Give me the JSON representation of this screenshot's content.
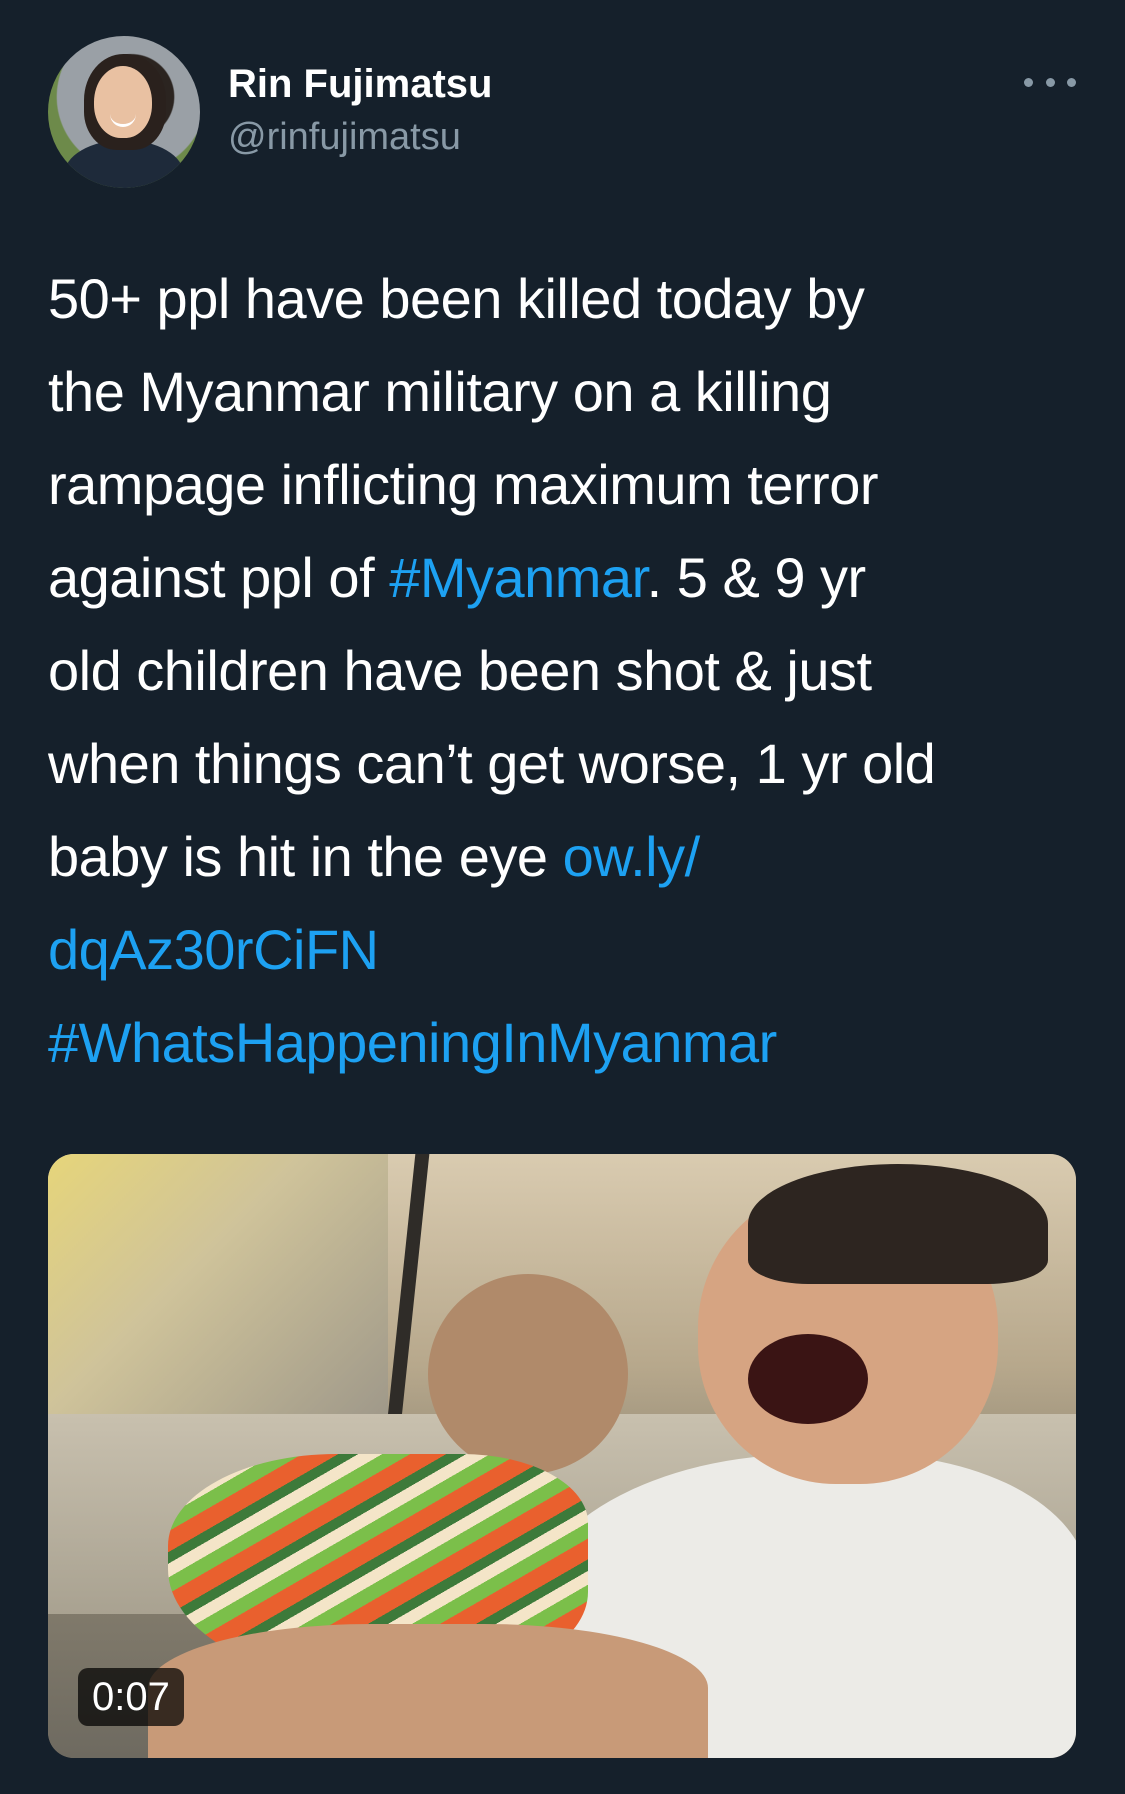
{
  "tweet": {
    "author": {
      "display_name": "Rin Fujimatsu",
      "handle": "@rinfujimatsu"
    },
    "text_lines": [
      [
        {
          "text": "50+ ppl have been killed today by",
          "link": false
        }
      ],
      [
        {
          "text": "the Myanmar military on a killing",
          "link": false
        }
      ],
      [
        {
          "text": "rampage inflicting maximum terror",
          "link": false
        }
      ],
      [
        {
          "text": "against ppl of ",
          "link": false
        },
        {
          "text": "#Myanmar",
          "link": true
        },
        {
          "text": ". 5 & 9 yr",
          "link": false
        }
      ],
      [
        {
          "text": "old children have been shot & just",
          "link": false
        }
      ],
      [
        {
          "text": "when things can’t get worse, 1 yr old",
          "link": false
        }
      ],
      [
        {
          "text": "baby is hit in the eye ",
          "link": false
        },
        {
          "text": "ow.ly/",
          "link": true
        }
      ],
      [
        {
          "text": "dqAz30rCiFN",
          "link": true
        }
      ],
      [
        {
          "text": "#WhatsHappeningInMyanmar",
          "link": true
        }
      ]
    ],
    "media": {
      "duration": "0:07"
    }
  },
  "colors": {
    "background": "#15202b",
    "text": "#ffffff",
    "secondary_text": "#8899a6",
    "link": "#1da1f2"
  },
  "icons": {
    "more": "more-horizontal-icon"
  }
}
